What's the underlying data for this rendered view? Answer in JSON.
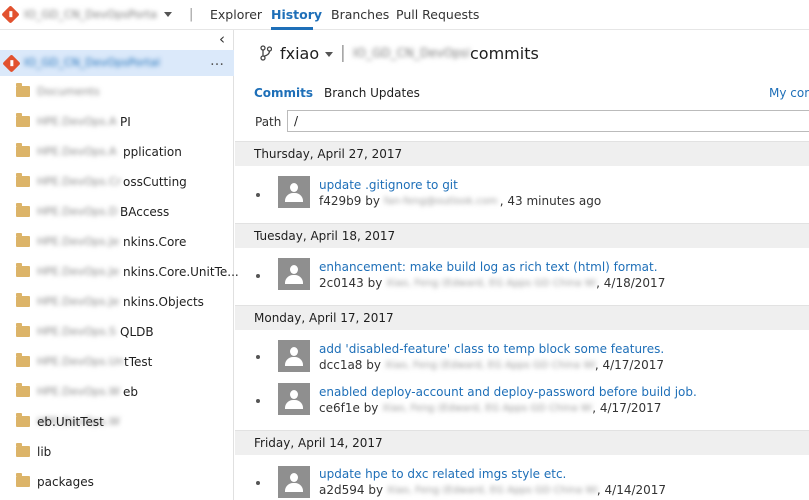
{
  "topbar": {
    "repo_name": "IO_GD_CN_DevOpsPortal",
    "separator": "|",
    "nav": [
      "Explorer",
      "History",
      "Branches",
      "Pull Requests"
    ],
    "active": "History"
  },
  "sidebar": {
    "collapse": "‹",
    "root": {
      "name": "IO_GD_CN_DevOpsPortal",
      "more": "…"
    },
    "items": [
      {
        "prefix": "Documents",
        "suffix": ""
      },
      {
        "prefix": "HPE.DevOps.A",
        "suffix": "PI"
      },
      {
        "prefix": "HPE.DevOps.A",
        "suffix": "pplication"
      },
      {
        "prefix": "HPE.DevOps.Cr",
        "suffix": "ossCutting"
      },
      {
        "prefix": "HPE.DevOps.D",
        "suffix": "BAccess"
      },
      {
        "prefix": "HPE.DevOps.Je",
        "suffix": "nkins.Core"
      },
      {
        "prefix": "HPE.DevOps.Je",
        "suffix": "nkins.Core.UnitTe..."
      },
      {
        "prefix": "HPE.DevOps.Je",
        "suffix": "nkins.Objects"
      },
      {
        "prefix": "HPE.DevOps.S",
        "suffix": "QLDB"
      },
      {
        "prefix": "HPE.DevOps.Uni",
        "suffix": "tTest"
      },
      {
        "prefix": "HPE.DevOps.W",
        "suffix": "eb"
      },
      {
        "prefix": "HPE.DevOps.W",
        "suffix": "eb.UnitTest"
      },
      {
        "prefix": "",
        "suffix": "lib"
      },
      {
        "prefix": "",
        "suffix": "packages"
      }
    ]
  },
  "main": {
    "branch": "fxiao",
    "title_sep": "|",
    "repo": "IO_GD_CN_DevOpsPortal",
    "title_suffix": "commits",
    "tabs": [
      "Commits",
      "Branch Updates"
    ],
    "my_commits": "My com",
    "path_label": "Path",
    "path_value": "/",
    "groups": [
      {
        "date": "Thursday, April 27, 2017",
        "commits": [
          {
            "title": "update .gitignore to git",
            "hash": "f429b9",
            "by": "by",
            "author": "fan-feng@outlook.com",
            "when": "43 minutes ago"
          }
        ]
      },
      {
        "date": "Tuesday, April 18, 2017",
        "commits": [
          {
            "title": "enhancement: make build log as rich text (html) format.",
            "hash": "2c0143",
            "by": "by",
            "author": "Xiao, Feng (Edward, EG Apps GD China WH)",
            "when": "4/18/2017"
          }
        ]
      },
      {
        "date": "Monday, April 17, 2017",
        "commits": [
          {
            "title": "add 'disabled-feature' class to temp block some features.",
            "hash": "dcc1a8",
            "by": "by",
            "author": "Xiao, Feng (Edward, EG Apps GD China WH)",
            "when": "4/17/2017"
          },
          {
            "title": "enabled deploy-account and deploy-password before build job.",
            "hash": "ce6f1e",
            "by": "by",
            "author": "Xiao, Feng (Edward, EG Apps GD China WH)",
            "when": "4/17/2017"
          }
        ]
      },
      {
        "date": "Friday, April 14, 2017",
        "commits": [
          {
            "title": "update hpe to dxc related imgs style etc.",
            "hash": "a2d594",
            "by": "by",
            "author": "Xiao, Feng (Edward, EG Apps GD China WH)",
            "when": "4/14/2017"
          }
        ]
      }
    ]
  }
}
